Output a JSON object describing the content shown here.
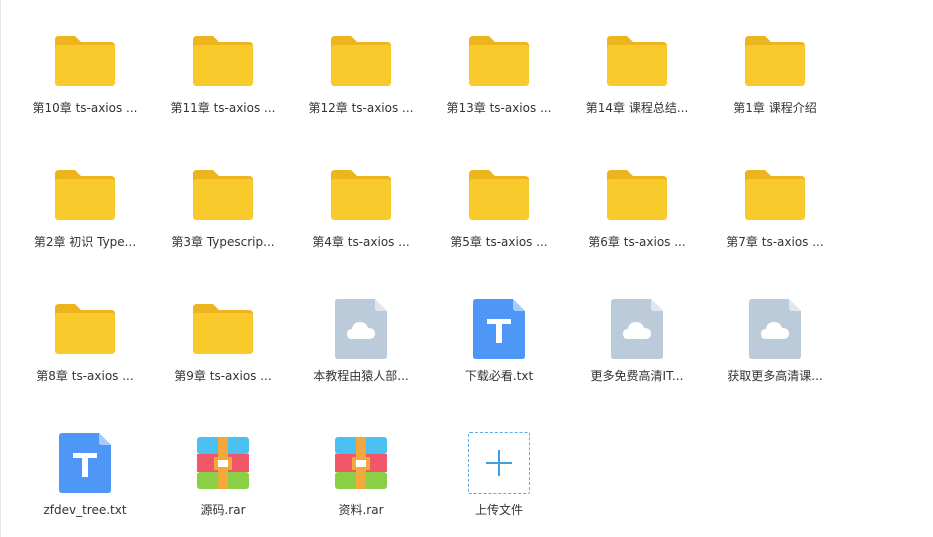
{
  "colors": {
    "folder": "#f8ca2b",
    "folder_tab": "#ecb51d",
    "txt_file": "#4f97f7",
    "cloud_file": "#bccbd9",
    "upload_accent": "#3fa0df"
  },
  "items": [
    {
      "label": "第10章 ts-axios ...",
      "icon": "folder-icon"
    },
    {
      "label": "第11章 ts-axios ...",
      "icon": "folder-icon"
    },
    {
      "label": "第12章 ts-axios ...",
      "icon": "folder-icon"
    },
    {
      "label": "第13章 ts-axios ...",
      "icon": "folder-icon"
    },
    {
      "label": "第14章 课程总结...",
      "icon": "folder-icon"
    },
    {
      "label": "第1章 课程介绍",
      "icon": "folder-icon"
    },
    {
      "label": "第2章 初识 Type...",
      "icon": "folder-icon"
    },
    {
      "label": "第3章 Typescrip...",
      "icon": "folder-icon"
    },
    {
      "label": "第4章 ts-axios ...",
      "icon": "folder-icon"
    },
    {
      "label": "第5章 ts-axios ...",
      "icon": "folder-icon"
    },
    {
      "label": "第6章 ts-axios ...",
      "icon": "folder-icon"
    },
    {
      "label": "第7章 ts-axios ...",
      "icon": "folder-icon"
    },
    {
      "label": "第8章 ts-axios ...",
      "icon": "folder-icon"
    },
    {
      "label": "第9章 ts-axios ...",
      "icon": "folder-icon"
    },
    {
      "label": "本教程由猿人部...",
      "icon": "cloud-file-icon"
    },
    {
      "label": "下载必看.txt",
      "icon": "txt-file-icon"
    },
    {
      "label": "更多免费高清IT...",
      "icon": "cloud-file-icon"
    },
    {
      "label": "获取更多高清课...",
      "icon": "cloud-file-icon"
    },
    {
      "label": "zfdev_tree.txt",
      "icon": "txt-file-icon"
    },
    {
      "label": "源码.rar",
      "icon": "rar-archive-icon"
    },
    {
      "label": "资料.rar",
      "icon": "rar-archive-icon"
    }
  ],
  "upload": {
    "label": "上传文件",
    "icon": "plus-icon"
  }
}
